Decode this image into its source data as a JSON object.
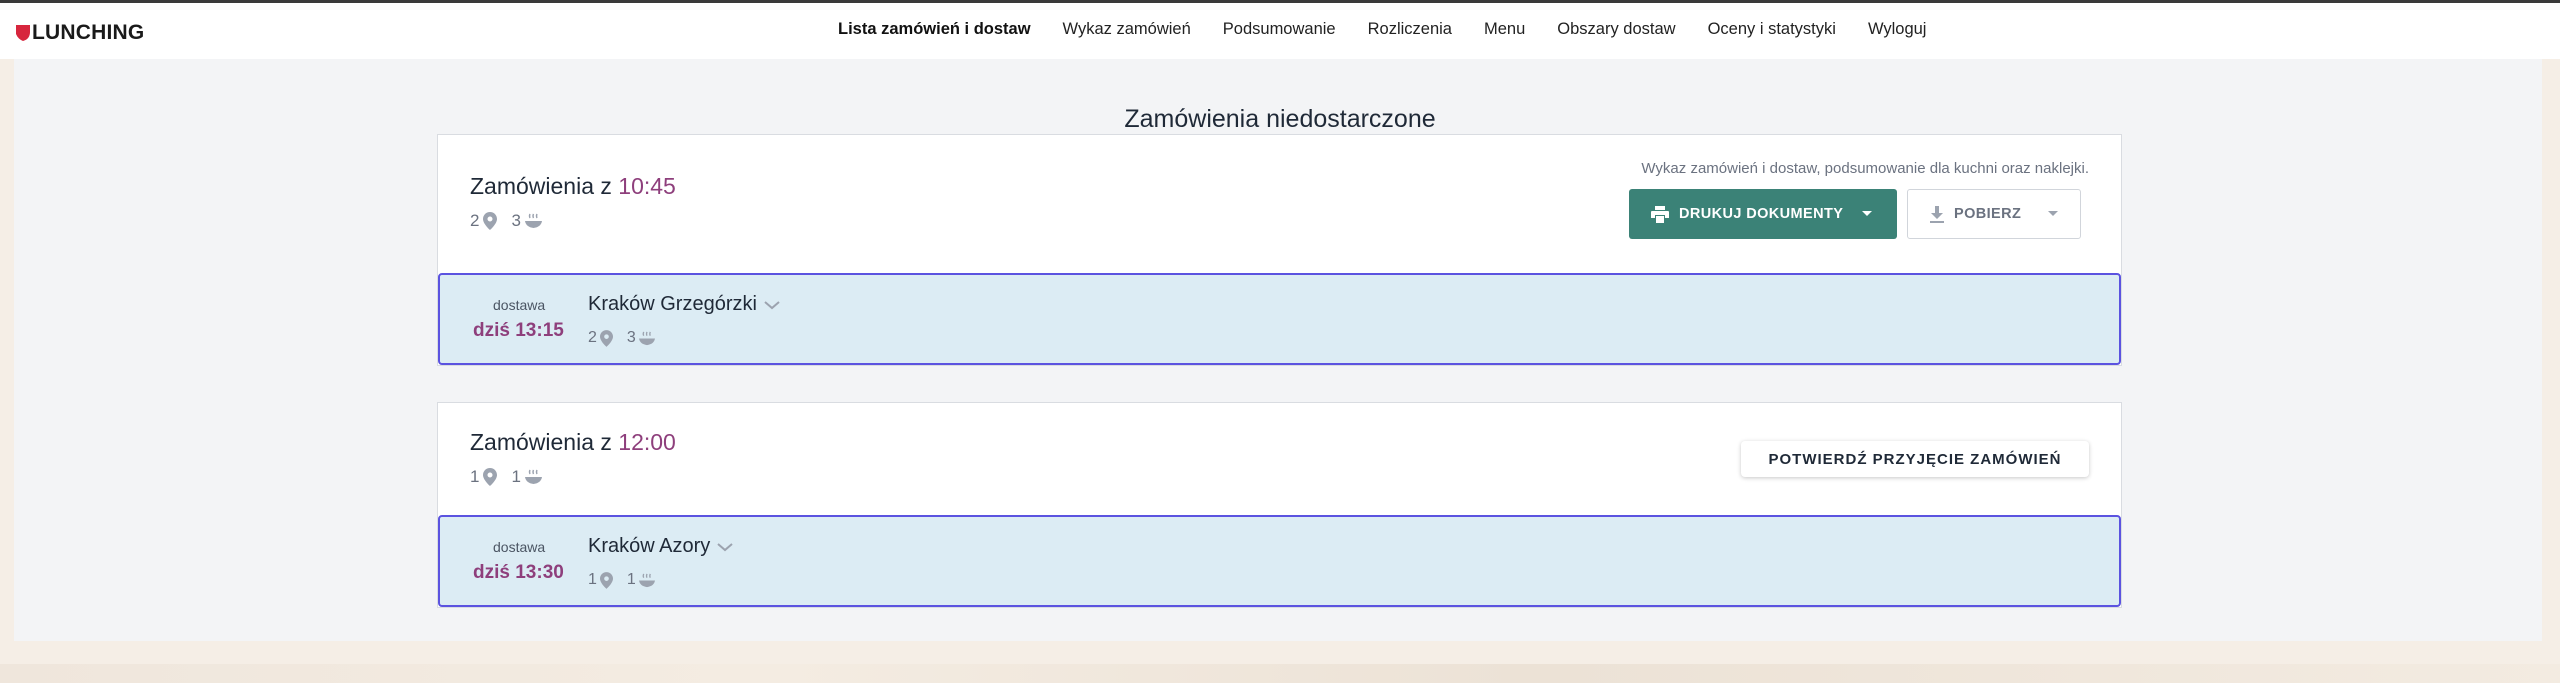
{
  "brand": {
    "name": "LUNCHING",
    "accent": "#d7263d"
  },
  "nav": {
    "items": [
      {
        "label": "Lista zamówień i dostaw",
        "active": true
      },
      {
        "label": "Wykaz zamówień"
      },
      {
        "label": "Podsumowanie"
      },
      {
        "label": "Rozliczenia"
      },
      {
        "label": "Menu"
      },
      {
        "label": "Obszary dostaw"
      },
      {
        "label": "Oceny i statystyki"
      },
      {
        "label": "Wyloguj"
      }
    ]
  },
  "page": {
    "title": "Zamówienia niedostarczone"
  },
  "groups": [
    {
      "title_prefix": "Zamówienia z",
      "time": "10:45",
      "locations": "2",
      "meals": "3",
      "hint": "Wykaz zamówień i dostaw, podsumowanie dla kuchni oraz naklejki.",
      "print_label": "DRUKUJ DOKUMENTY",
      "download_label": "POBIERZ",
      "delivery": {
        "label": "dostawa",
        "time": "dziś 13:15",
        "city": "Kraków Grzegórzki",
        "locations": "2",
        "meals": "3"
      }
    },
    {
      "title_prefix": "Zamówienia z",
      "time": "12:00",
      "locations": "1",
      "meals": "1",
      "confirm_label": "POTWIERDŹ PRZYJĘCIE ZAMÓWIEŃ",
      "delivery": {
        "label": "dostawa",
        "time": "dziś 13:30",
        "city": "Kraków Azory",
        "locations": "1",
        "meals": "1"
      }
    }
  ],
  "icons": {
    "location": "map-pin-icon",
    "meal": "bowl-icon",
    "print": "printer-icon",
    "download": "download-icon",
    "chevron": "chevron-down-icon"
  },
  "colors": {
    "time_accent": "#8e3f7c",
    "primary_button": "#3b8277",
    "delivery_bg": "#dcecf4",
    "delivery_border": "#5b53e0"
  }
}
